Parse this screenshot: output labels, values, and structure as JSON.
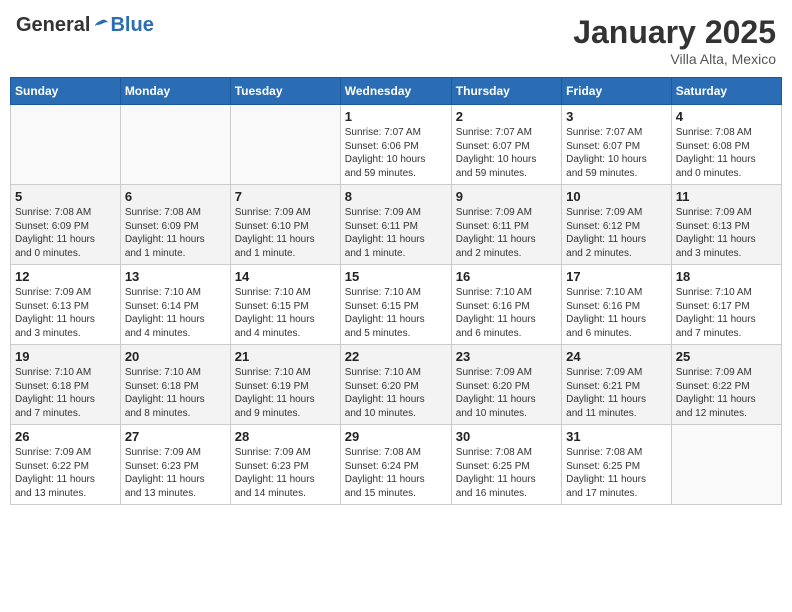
{
  "header": {
    "logo_general": "General",
    "logo_blue": "Blue",
    "month": "January 2025",
    "location": "Villa Alta, Mexico"
  },
  "days_of_week": [
    "Sunday",
    "Monday",
    "Tuesday",
    "Wednesday",
    "Thursday",
    "Friday",
    "Saturday"
  ],
  "weeks": [
    [
      {
        "day": "",
        "info": ""
      },
      {
        "day": "",
        "info": ""
      },
      {
        "day": "",
        "info": ""
      },
      {
        "day": "1",
        "info": "Sunrise: 7:07 AM\nSunset: 6:06 PM\nDaylight: 10 hours\nand 59 minutes."
      },
      {
        "day": "2",
        "info": "Sunrise: 7:07 AM\nSunset: 6:07 PM\nDaylight: 10 hours\nand 59 minutes."
      },
      {
        "day": "3",
        "info": "Sunrise: 7:07 AM\nSunset: 6:07 PM\nDaylight: 10 hours\nand 59 minutes."
      },
      {
        "day": "4",
        "info": "Sunrise: 7:08 AM\nSunset: 6:08 PM\nDaylight: 11 hours\nand 0 minutes."
      }
    ],
    [
      {
        "day": "5",
        "info": "Sunrise: 7:08 AM\nSunset: 6:09 PM\nDaylight: 11 hours\nand 0 minutes."
      },
      {
        "day": "6",
        "info": "Sunrise: 7:08 AM\nSunset: 6:09 PM\nDaylight: 11 hours\nand 1 minute."
      },
      {
        "day": "7",
        "info": "Sunrise: 7:09 AM\nSunset: 6:10 PM\nDaylight: 11 hours\nand 1 minute."
      },
      {
        "day": "8",
        "info": "Sunrise: 7:09 AM\nSunset: 6:11 PM\nDaylight: 11 hours\nand 1 minute."
      },
      {
        "day": "9",
        "info": "Sunrise: 7:09 AM\nSunset: 6:11 PM\nDaylight: 11 hours\nand 2 minutes."
      },
      {
        "day": "10",
        "info": "Sunrise: 7:09 AM\nSunset: 6:12 PM\nDaylight: 11 hours\nand 2 minutes."
      },
      {
        "day": "11",
        "info": "Sunrise: 7:09 AM\nSunset: 6:13 PM\nDaylight: 11 hours\nand 3 minutes."
      }
    ],
    [
      {
        "day": "12",
        "info": "Sunrise: 7:09 AM\nSunset: 6:13 PM\nDaylight: 11 hours\nand 3 minutes."
      },
      {
        "day": "13",
        "info": "Sunrise: 7:10 AM\nSunset: 6:14 PM\nDaylight: 11 hours\nand 4 minutes."
      },
      {
        "day": "14",
        "info": "Sunrise: 7:10 AM\nSunset: 6:15 PM\nDaylight: 11 hours\nand 4 minutes."
      },
      {
        "day": "15",
        "info": "Sunrise: 7:10 AM\nSunset: 6:15 PM\nDaylight: 11 hours\nand 5 minutes."
      },
      {
        "day": "16",
        "info": "Sunrise: 7:10 AM\nSunset: 6:16 PM\nDaylight: 11 hours\nand 6 minutes."
      },
      {
        "day": "17",
        "info": "Sunrise: 7:10 AM\nSunset: 6:16 PM\nDaylight: 11 hours\nand 6 minutes."
      },
      {
        "day": "18",
        "info": "Sunrise: 7:10 AM\nSunset: 6:17 PM\nDaylight: 11 hours\nand 7 minutes."
      }
    ],
    [
      {
        "day": "19",
        "info": "Sunrise: 7:10 AM\nSunset: 6:18 PM\nDaylight: 11 hours\nand 7 minutes."
      },
      {
        "day": "20",
        "info": "Sunrise: 7:10 AM\nSunset: 6:18 PM\nDaylight: 11 hours\nand 8 minutes."
      },
      {
        "day": "21",
        "info": "Sunrise: 7:10 AM\nSunset: 6:19 PM\nDaylight: 11 hours\nand 9 minutes."
      },
      {
        "day": "22",
        "info": "Sunrise: 7:10 AM\nSunset: 6:20 PM\nDaylight: 11 hours\nand 10 minutes."
      },
      {
        "day": "23",
        "info": "Sunrise: 7:09 AM\nSunset: 6:20 PM\nDaylight: 11 hours\nand 10 minutes."
      },
      {
        "day": "24",
        "info": "Sunrise: 7:09 AM\nSunset: 6:21 PM\nDaylight: 11 hours\nand 11 minutes."
      },
      {
        "day": "25",
        "info": "Sunrise: 7:09 AM\nSunset: 6:22 PM\nDaylight: 11 hours\nand 12 minutes."
      }
    ],
    [
      {
        "day": "26",
        "info": "Sunrise: 7:09 AM\nSunset: 6:22 PM\nDaylight: 11 hours\nand 13 minutes."
      },
      {
        "day": "27",
        "info": "Sunrise: 7:09 AM\nSunset: 6:23 PM\nDaylight: 11 hours\nand 13 minutes."
      },
      {
        "day": "28",
        "info": "Sunrise: 7:09 AM\nSunset: 6:23 PM\nDaylight: 11 hours\nand 14 minutes."
      },
      {
        "day": "29",
        "info": "Sunrise: 7:08 AM\nSunset: 6:24 PM\nDaylight: 11 hours\nand 15 minutes."
      },
      {
        "day": "30",
        "info": "Sunrise: 7:08 AM\nSunset: 6:25 PM\nDaylight: 11 hours\nand 16 minutes."
      },
      {
        "day": "31",
        "info": "Sunrise: 7:08 AM\nSunset: 6:25 PM\nDaylight: 11 hours\nand 17 minutes."
      },
      {
        "day": "",
        "info": ""
      }
    ]
  ]
}
